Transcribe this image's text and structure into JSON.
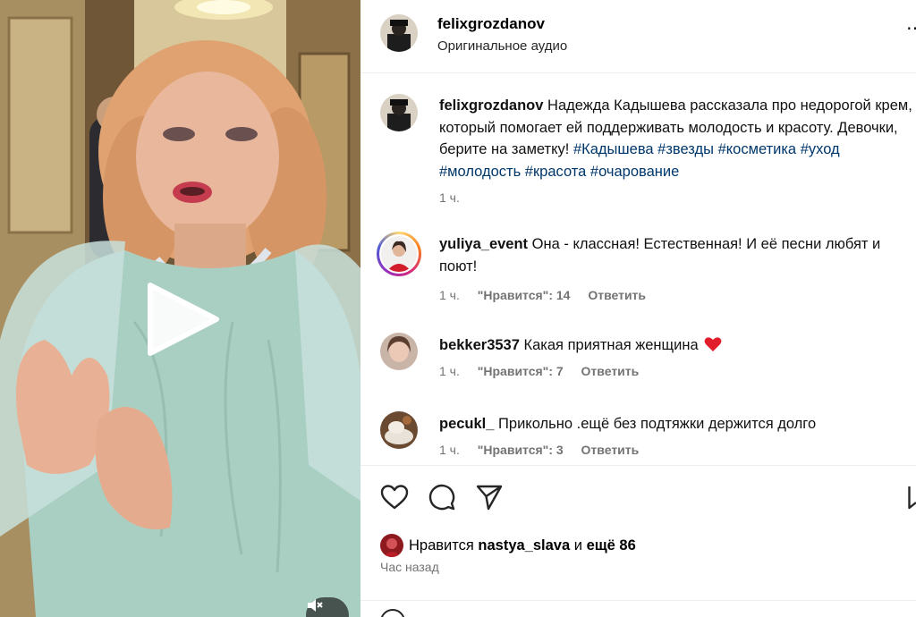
{
  "post": {
    "username": "felixgrozdanov",
    "audio_label": "Оригинальное аудио",
    "more_icon": "more-dots-icon"
  },
  "caption": {
    "username": "felixgrozdanov",
    "text": "Надежда Кадышева рассказала про недорогой крем, который помогает ей поддерживать молодость и красоту. Девочки, берите на заметку!",
    "hashtags": [
      "#Кадышева",
      "#звезды",
      "#косметика",
      "#уход",
      "#молодость",
      "#красота",
      "#очарование"
    ],
    "time": "1 ч."
  },
  "comments": [
    {
      "username": "yuliya_event",
      "text": "Она - классная! Естественная! И её песни любят и поют!",
      "time": "1 ч.",
      "likes": "\"Нравится\": 14",
      "reply": "Ответить",
      "has_story": true
    },
    {
      "username": "bekker3537",
      "text": "Какая приятная женщина",
      "emoji": "❤️",
      "time": "1 ч.",
      "likes": "\"Нравится\": 7",
      "reply": "Ответить",
      "has_story": false
    },
    {
      "username": "pecukl_",
      "text": "Прикольно .ещё без подтяжки держится долго",
      "time": "1 ч.",
      "likes": "\"Нравится\": 3",
      "reply": "Ответить",
      "has_story": false
    }
  ],
  "actions": {
    "like_icon": "heart-outline-icon",
    "comment_icon": "comment-bubble-icon",
    "share_icon": "paper-plane-icon",
    "save_icon": "bookmark-icon"
  },
  "likes": {
    "prefix": "Нравится",
    "user": "nastya_slava",
    "connector": "и",
    "others": "ещё 86"
  },
  "time_ago": "Час назад",
  "media": {
    "play_icon": "play-icon",
    "mute_icon": "muted-speaker-icon"
  },
  "colors": {
    "link": "#00376b",
    "meta": "#737373",
    "heart": "#ed4956",
    "dress": "#a9cfc3"
  }
}
